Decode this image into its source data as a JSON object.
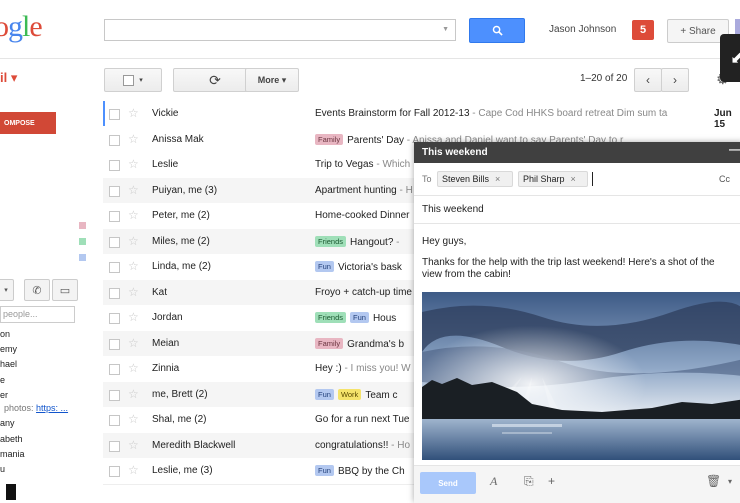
{
  "header": {
    "logo": [
      "o",
      "g",
      "l",
      "e"
    ],
    "logo_colors": [
      "#dd4b39",
      "#4885ed",
      "#3cba54",
      "#dd4b39"
    ],
    "user_name": "Jason Johnson",
    "notifications": "5",
    "share_label": "+ Share"
  },
  "toolbar": {
    "mail_label": "il ▾",
    "more_label": "More ▾",
    "range": "1–20 of 20"
  },
  "sidebar": {
    "compose_label": "OMPOSE",
    "search_placeholder": "people...",
    "contacts": [
      "on",
      "emy",
      "hael",
      "e",
      "er",
      "photos:",
      "https: ...",
      "any",
      "abeth",
      "mania",
      "u"
    ],
    "label_colors": [
      "#e8b6c2",
      "#9fdfb8",
      "#b3c8f0"
    ]
  },
  "emails": [
    {
      "sender": "Vickie",
      "labels": [],
      "subject": "Events Brainstorm for Fall 2012-13",
      "snippet": " - Cape Cod HHKS board retreat Dim sum ta",
      "date": "Jun 15"
    },
    {
      "sender": "Anissa Mak",
      "labels": [
        {
          "text": "Family",
          "bg": "#e8b6c2",
          "fg": "#6b3540"
        }
      ],
      "subject": "Parents' Day",
      "snippet": " - Anissa and Daniel want to say Parents' Day to r",
      "date": ""
    },
    {
      "sender": "Leslie",
      "labels": [],
      "subject": "Trip to Vegas",
      "snippet": " - Which",
      "date": ""
    },
    {
      "sender": "Puiyan, me (3)",
      "labels": [],
      "subject": "Apartment hunting",
      "snippet": " - H",
      "date": ""
    },
    {
      "sender": "Peter, me (2)",
      "labels": [],
      "subject": "Home-cooked Dinner",
      "snippet": "",
      "date": ""
    },
    {
      "sender": "Miles, me (2)",
      "labels": [
        {
          "text": "Friends",
          "bg": "#9fdfb8",
          "fg": "#1c5a32"
        }
      ],
      "subject": "Hangout?",
      "snippet": " -",
      "date": ""
    },
    {
      "sender": "Linda, me (2)",
      "labels": [
        {
          "text": "Fun",
          "bg": "#b3c8f0",
          "fg": "#23407a"
        }
      ],
      "subject": "Victoria's bask",
      "snippet": "",
      "date": ""
    },
    {
      "sender": "Kat",
      "labels": [],
      "subject": "Froyo + catch-up time",
      "snippet": "",
      "date": ""
    },
    {
      "sender": "Jordan",
      "labels": [
        {
          "text": "Friends",
          "bg": "#9fdfb8",
          "fg": "#1c5a32"
        },
        {
          "text": "Fun",
          "bg": "#b3c8f0",
          "fg": "#23407a"
        }
      ],
      "subject": "Hous",
      "snippet": "",
      "date": ""
    },
    {
      "sender": "Meian",
      "labels": [
        {
          "text": "Family",
          "bg": "#e8b6c2",
          "fg": "#6b3540"
        }
      ],
      "subject": "Grandma's b",
      "snippet": "",
      "date": ""
    },
    {
      "sender": "Zinnia",
      "labels": [],
      "subject": "Hey :)",
      "snippet": " - I miss you! W",
      "date": ""
    },
    {
      "sender": "me, Brett (2)",
      "labels": [
        {
          "text": "Fun",
          "bg": "#b3c8f0",
          "fg": "#23407a"
        },
        {
          "text": "Work",
          "bg": "#f5e36b",
          "fg": "#5a4a00"
        }
      ],
      "subject": "Team c",
      "snippet": "",
      "date": ""
    },
    {
      "sender": "Shal, me (2)",
      "labels": [],
      "subject": "Go for a run next Tue",
      "snippet": "",
      "date": ""
    },
    {
      "sender": "Meredith Blackwell",
      "labels": [],
      "subject": "congratulations!!",
      "snippet": " - Ho",
      "date": ""
    },
    {
      "sender": "Leslie, me (3)",
      "labels": [
        {
          "text": "Fun",
          "bg": "#b3c8f0",
          "fg": "#23407a"
        }
      ],
      "subject": "BBQ by the Ch",
      "snippet": "",
      "date": ""
    }
  ],
  "compose": {
    "title": "This weekend",
    "minimize": "—",
    "to_label": "To",
    "recipients": [
      "Steven Bills",
      "Phil Sharp"
    ],
    "cc_label": "Cc",
    "subject": "This weekend",
    "greeting": "Hey guys,",
    "body": "Thanks for the help with the trip last weekend!  Here's a shot of the view from the cabin!",
    "send_label": "Send"
  }
}
